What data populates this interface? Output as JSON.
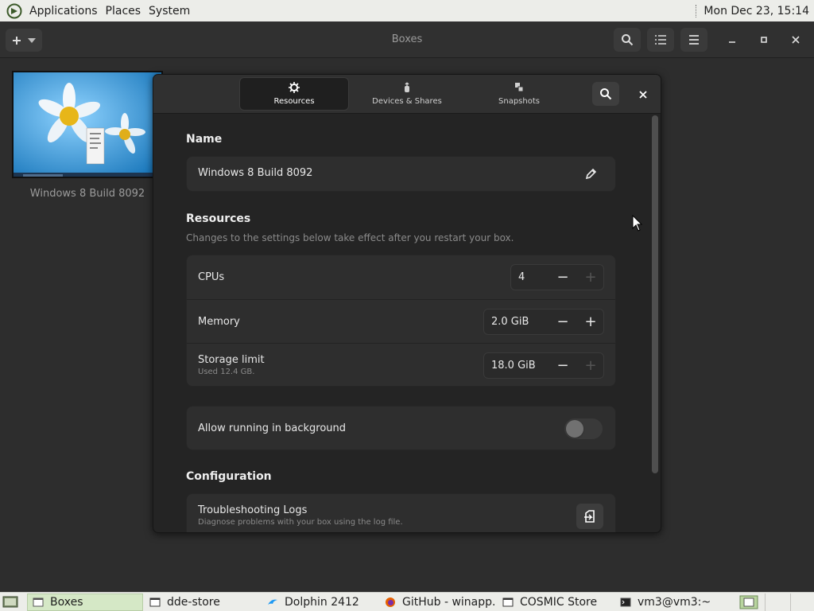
{
  "top_panel": {
    "menus": [
      "Applications",
      "Places",
      "System"
    ],
    "clock": "Mon Dec 23, 15:14"
  },
  "header": {
    "title": "Boxes",
    "icons": [
      "plus-icon",
      "chevron-down-icon",
      "search-icon",
      "list-view-icon",
      "menu-icon",
      "minimize-icon",
      "maximize-icon",
      "close-icon"
    ]
  },
  "box": {
    "name": "Windows 8 Build 8092"
  },
  "dialog": {
    "tabs": [
      {
        "label": "Resources",
        "icon": "gear-icon",
        "active": true
      },
      {
        "label": "Devices & Shares",
        "icon": "usb-icon",
        "active": false
      },
      {
        "label": "Snapshots",
        "icon": "snapshots-icon",
        "active": false
      }
    ],
    "name_section": {
      "title": "Name",
      "value": "Windows 8 Build 8092"
    },
    "resources_section": {
      "title": "Resources",
      "subtitle": "Changes to the settings below take effect after you restart your box.",
      "rows": [
        {
          "label": "CPUs",
          "sublabel": "",
          "value": "4",
          "plus_enabled": false
        },
        {
          "label": "Memory",
          "sublabel": "",
          "value": "2.0 GiB",
          "plus_enabled": true
        },
        {
          "label": "Storage limit",
          "sublabel": "Used 12.4 GB.",
          "value": "18.0 GiB",
          "plus_enabled": false
        }
      ],
      "minus_symbol": "−",
      "plus_symbol": "+"
    },
    "background_row": {
      "label": "Allow running in background",
      "enabled": false
    },
    "configuration_section": {
      "title": "Configuration",
      "logs_title": "Troubleshooting Logs",
      "logs_subtitle": "Diagnose problems with your box using the log file."
    }
  },
  "taskbar": {
    "items": [
      {
        "label": "Boxes",
        "active": true
      },
      {
        "label": "dde-store",
        "active": false
      },
      {
        "label": "Dolphin 2412",
        "active": false
      },
      {
        "label": "GitHub - winapp...",
        "active": false
      },
      {
        "label": "COSMIC Store",
        "active": false
      },
      {
        "label": "vm3@vm3:~",
        "active": false
      }
    ]
  },
  "colors": {
    "background": "#2d2d2d",
    "dialog": "#242424",
    "card": "#2e2e2e",
    "panel": "#ecede9",
    "taskbar_active": "#d5e8c6"
  }
}
